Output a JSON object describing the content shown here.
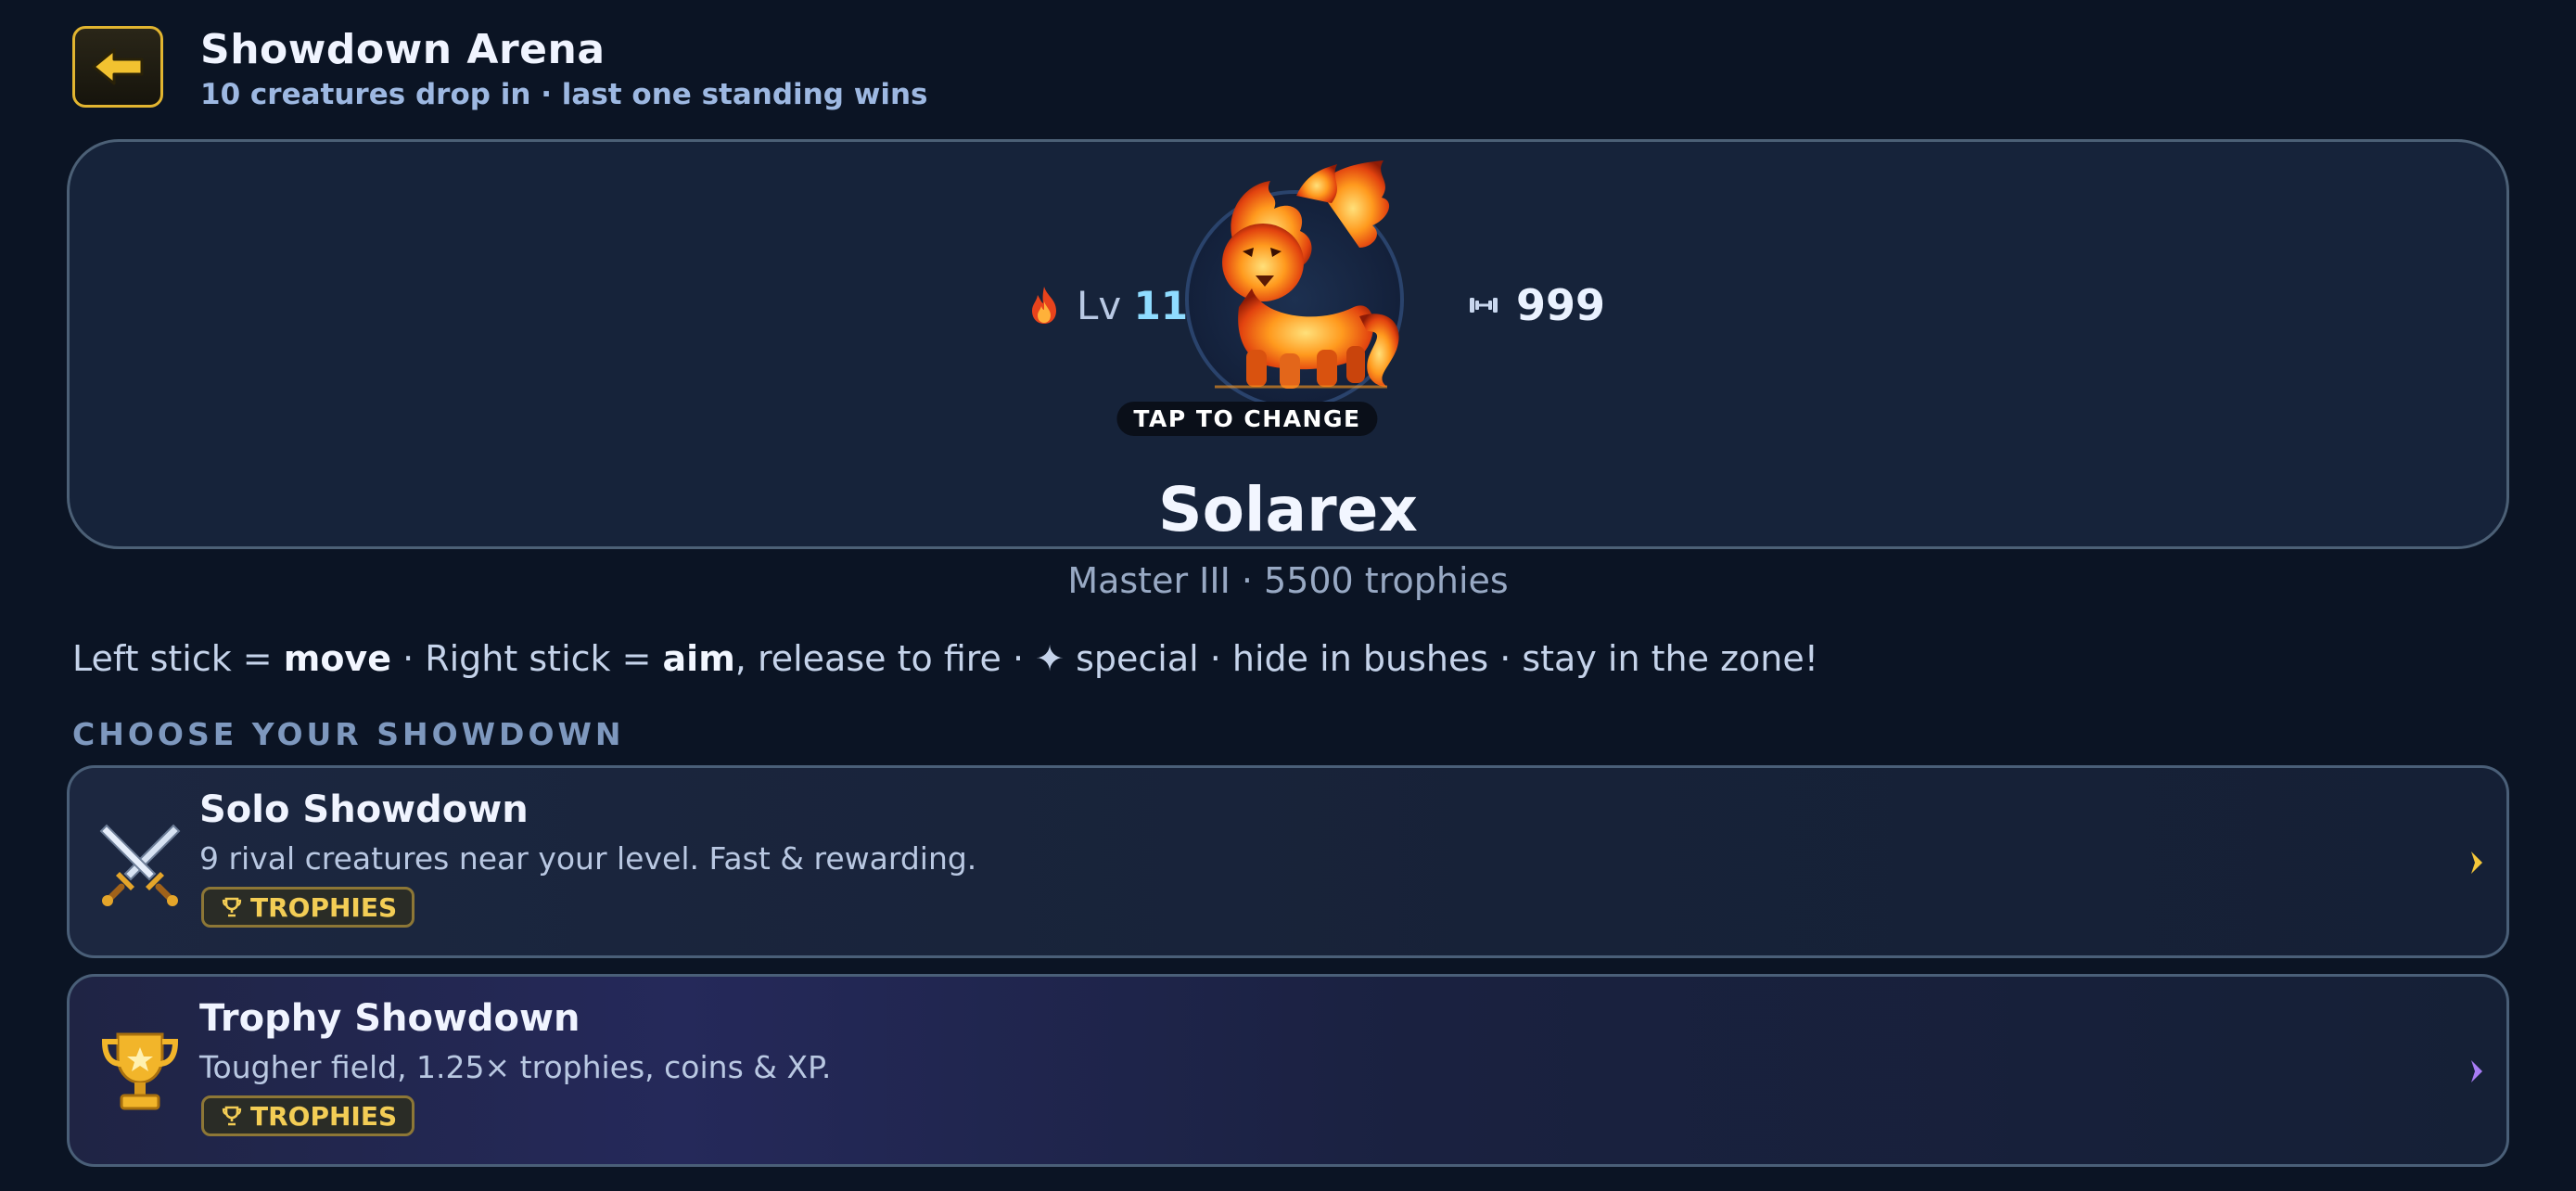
{
  "header": {
    "title": "Showdown Arena",
    "subtitle": "10 creatures drop in · last one standing wins"
  },
  "creature": {
    "level_prefix": "Lv",
    "level": "11",
    "power": "999",
    "tap_hint": "TAP TO CHANGE",
    "name": "Solarex",
    "rank": "Master III · 5500 trophies"
  },
  "controls": {
    "part1": "Left stick = ",
    "move": "move",
    "part2": " · Right stick = ",
    "aim": "aim",
    "part3": ", release to fire · ✦ special · hide in bushes · stay in the zone!"
  },
  "section_heading": "CHOOSE YOUR SHOWDOWN",
  "modes": [
    {
      "title": "Solo Showdown",
      "description": "9 rival creatures near your level. Fast & rewarding.",
      "badge": "TROPHIES",
      "icon": "crossed-swords-icon",
      "chevron_color": "#f5c73a"
    },
    {
      "title": "Trophy Showdown",
      "description": "Tougher field, 1.25× trophies, coins & XP.",
      "badge": "TROPHIES",
      "icon": "trophy-cup-icon",
      "chevron_color": "#a87cf5"
    }
  ],
  "colors": {
    "background": "#0b1424",
    "accent_gold": "#f3cd55",
    "level_blue": "#8fdcff"
  }
}
